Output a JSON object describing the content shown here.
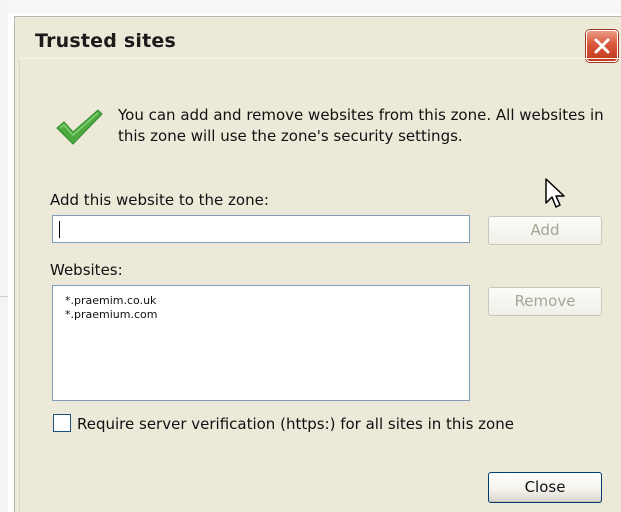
{
  "dialog": {
    "title": "Trusted sites",
    "close_icon": "close-x-icon",
    "info_icon": "green-checkmark-icon",
    "intro_text": "You can add and remove websites from this zone. All websites in this zone will use the zone's security settings."
  },
  "add_site": {
    "label": "Add this website to the zone:",
    "value": "",
    "button": "Add"
  },
  "websites": {
    "label": "Websites:",
    "items": [
      "*.praemim.co.uk",
      "*.praemium.com"
    ],
    "remove_button": "Remove"
  },
  "https_check": {
    "label": "Require server verification (https:) for all sites in this zone",
    "checked": false
  },
  "footer": {
    "close_button": "Close"
  },
  "colors": {
    "dialog_bg": "#ece9d8",
    "close_red": "#d9573a",
    "check_green": "#3fa33a",
    "field_border": "#7f9db9"
  }
}
